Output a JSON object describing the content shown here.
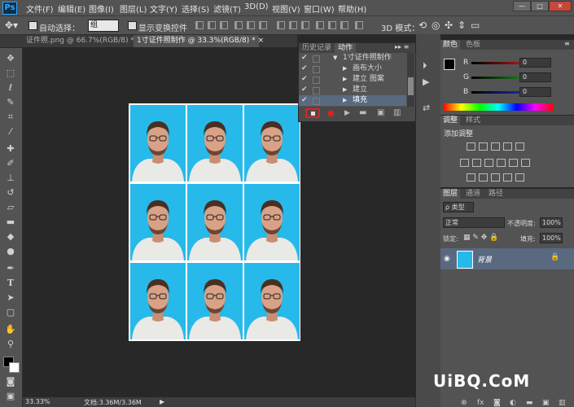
{
  "app": {
    "logo": "Ps"
  },
  "menu": [
    "文件(F)",
    "编辑(E)",
    "图像(I)",
    "图层(L)",
    "文字(Y)",
    "选择(S)",
    "滤镜(T)",
    "3D(D)",
    "视图(V)",
    "窗口(W)",
    "帮助(H)"
  ],
  "window_controls": [
    "—",
    "□",
    "✕"
  ],
  "options": {
    "auto_select_label": "自动选择：",
    "auto_select_value": "组",
    "show_transform_label": "显示变换控件",
    "mode_3d_label": "3D 模式："
  },
  "doc_tabs": [
    {
      "label": "证件照.png @ 66.7%(RGB/8) *",
      "close": "×",
      "active": false
    },
    {
      "label": "1寸证件照制作 @ 33.3%(RGB/8) *",
      "close": "×",
      "active": true
    }
  ],
  "tools": [
    "move-tool-icon",
    "marquee-tool-icon",
    "lasso-tool-icon",
    "quick-select-tool-icon",
    "crop-tool-icon",
    "eyedropper-tool-icon",
    "healing-brush-tool-icon",
    "brush-tool-icon",
    "clone-stamp-tool-icon",
    "history-brush-tool-icon",
    "eraser-tool-icon",
    "gradient-tool-icon",
    "blur-tool-icon",
    "dodge-tool-icon",
    "pen-tool-icon",
    "type-tool-icon",
    "path-select-tool-icon",
    "shape-tool-icon",
    "hand-tool-icon",
    "zoom-tool-icon"
  ],
  "status": {
    "zoom": "33.33%",
    "doc_size": "文档:3.36M/3.36M"
  },
  "actions_panel": {
    "tabs": [
      "历史记录",
      "动作"
    ],
    "active_tab": "动作",
    "rows": [
      {
        "indent": 0,
        "label": "1寸证件照制作",
        "expanded": true,
        "selected": false
      },
      {
        "indent": 1,
        "label": "画布大小",
        "expanded": false,
        "selected": false
      },
      {
        "indent": 1,
        "label": "建立 图案",
        "expanded": false,
        "selected": false
      },
      {
        "indent": 1,
        "label": "建立",
        "expanded": false,
        "selected": false
      },
      {
        "indent": 1,
        "label": "填充",
        "expanded": false,
        "selected": true
      }
    ],
    "buttons": [
      "stop-button",
      "record-button",
      "play-button",
      "new-set-button",
      "new-action-button",
      "delete-button"
    ]
  },
  "color_panel": {
    "tabs": [
      "颜色",
      "色板"
    ],
    "channels": [
      {
        "label": "R",
        "value": "0",
        "color": "#ff2020"
      },
      {
        "label": "G",
        "value": "0",
        "color": "#20c020"
      },
      {
        "label": "B",
        "value": "0",
        "color": "#2040ff"
      }
    ]
  },
  "adjust_panel": {
    "tabs": [
      "调整",
      "样式"
    ],
    "title": "添加调整"
  },
  "layers_panel": {
    "tabs": [
      "图层",
      "通道",
      "路径"
    ],
    "kind_filter": "ρ 类型",
    "blend_mode": "正常",
    "opacity_label": "不透明度:",
    "opacity_value": "100%",
    "lock_label": "锁定:",
    "fill_label": "填充:",
    "fill_value": "100%",
    "layer_name": "背景"
  },
  "watermark": "UiBQ.CoM",
  "colors": {
    "photo_bg": "#27b9ea",
    "panel": "#535353",
    "selected_layer": "#596a80",
    "record_red": "#e02020"
  }
}
